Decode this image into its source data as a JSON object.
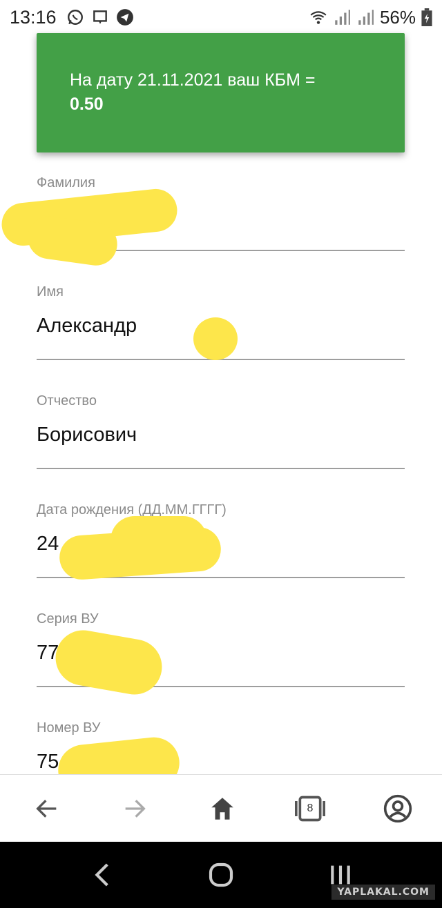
{
  "status_bar": {
    "time": "13:16",
    "battery_pct": "56%"
  },
  "kbm_card": {
    "message": "На дату 21.11.2021 ваш КБМ =",
    "value": "0.50",
    "color": "#43a047"
  },
  "form": {
    "fields": [
      {
        "label": "Фамилия",
        "value": ""
      },
      {
        "label": "Имя",
        "value": "Александр"
      },
      {
        "label": "Отчество",
        "value": "Борисович"
      },
      {
        "label": "Дата рождения (ДД.ММ.ГГГГ)",
        "value": "24"
      },
      {
        "label": "Серия ВУ",
        "value": "77"
      },
      {
        "label": "Номер ВУ",
        "value": "75"
      }
    ]
  },
  "toolbar": {
    "tabs_count": "8"
  },
  "icons": [
    "whatsapp-icon",
    "message-icon",
    "telegram-icon",
    "wifi-icon",
    "signal-icon",
    "battery-icon",
    "back-arrow-icon",
    "forward-arrow-icon",
    "home-icon",
    "tabs-icon",
    "profile-icon",
    "nav-back-icon",
    "nav-home-icon",
    "nav-recents-icon"
  ],
  "watermark": "YAPLAKAL.COM",
  "colors": {
    "redaction": "#fde64b",
    "accent": "#43a047"
  }
}
